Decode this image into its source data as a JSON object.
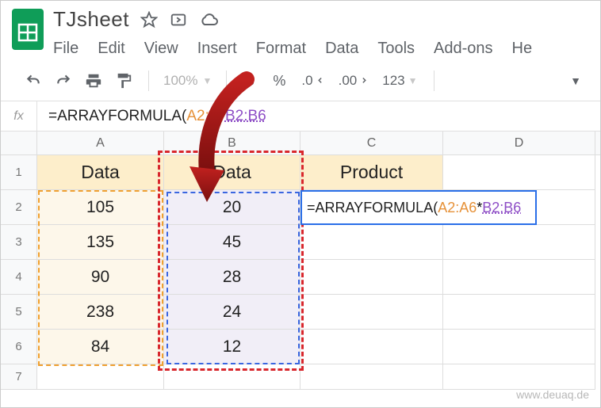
{
  "doc": {
    "title": "TJsheet"
  },
  "menu": {
    "file": "File",
    "edit": "Edit",
    "view": "View",
    "insert": "Insert",
    "format": "Format",
    "data": "Data",
    "tools": "Tools",
    "addons": "Add-ons",
    "help": "He"
  },
  "toolbar": {
    "zoom": "100%",
    "currency": "$",
    "percent": "%",
    "dec_dec": ".0",
    "inc_dec": ".00",
    "more_fmt": "123"
  },
  "fx": {
    "prefix": "=ARRAYFORMULA(",
    "rangeA": "A2:A",
    "star": "*",
    "rangeB": "B2:B6"
  },
  "columns": {
    "A": "A",
    "B": "B",
    "C": "C",
    "D": "D"
  },
  "headers": {
    "A": "Data",
    "B": "Data",
    "C": "Product"
  },
  "rows": {
    "r2": {
      "A": "105",
      "B": "20"
    },
    "r3": {
      "A": "135",
      "B": "45"
    },
    "r4": {
      "A": "90",
      "B": "28"
    },
    "r5": {
      "A": "238",
      "B": "24"
    },
    "r6": {
      "A": "84",
      "B": "12"
    }
  },
  "cellFormula": {
    "prefix": "=ARRAYFORMULA(",
    "rangeA": "A2:A6",
    "star": "*",
    "rangeB": "B2:B6"
  },
  "rownums": {
    "1": "1",
    "2": "2",
    "3": "3",
    "4": "4",
    "5": "5",
    "6": "6",
    "7": "7"
  },
  "watermark": "www.deuaq.de"
}
